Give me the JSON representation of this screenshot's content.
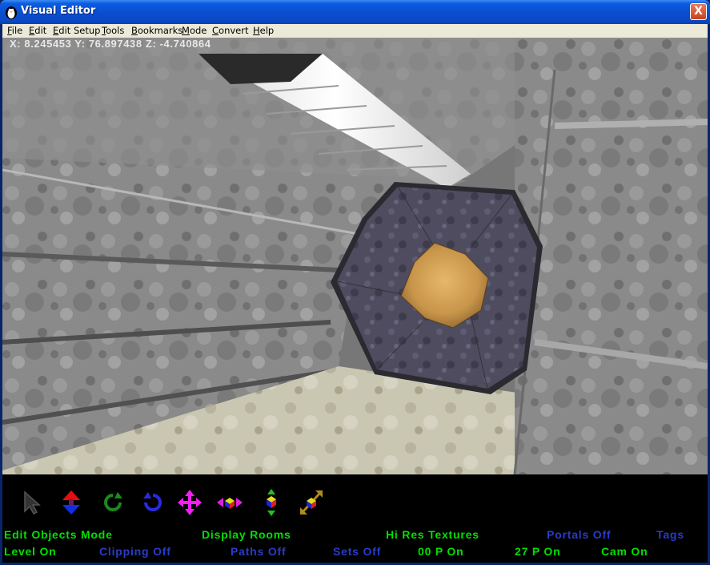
{
  "window": {
    "title": "Visual Editor",
    "close_label": "X"
  },
  "menu": [
    {
      "name": "menu-file",
      "accel": "F",
      "rest": "ile"
    },
    {
      "name": "menu-edit",
      "accel": "E",
      "rest": "dit"
    },
    {
      "name": "menu-edit-setup",
      "accel": "E",
      "rest": "dit Setup"
    },
    {
      "name": "menu-tools",
      "accel": "T",
      "rest": "ools"
    },
    {
      "name": "menu-bookmarks",
      "accel": "B",
      "rest": "ookmarks"
    },
    {
      "name": "menu-mode",
      "accel": "M",
      "rest": "ode"
    },
    {
      "name": "menu-convert",
      "accel": "C",
      "rest": "onvert"
    },
    {
      "name": "menu-help",
      "accel": "H",
      "rest": "elp"
    }
  ],
  "coords": {
    "text": "X: 8.245453 Y: 76.897438 Z: -4.740864"
  },
  "toolbar": [
    {
      "name": "select-arrow-icon"
    },
    {
      "name": "move-vertical-icon"
    },
    {
      "name": "rotate-green-icon"
    },
    {
      "name": "rotate-blue-icon"
    },
    {
      "name": "move-4way-icon"
    },
    {
      "name": "move-horizontal-cube-icon"
    },
    {
      "name": "move-vertical-cube-icon"
    },
    {
      "name": "scale-diagonal-cube-icon"
    }
  ],
  "status": {
    "row1": [
      {
        "name": "status-edit-objects-mode",
        "text": "Edit Objects Mode",
        "color": "#00e000"
      },
      {
        "name": "status-display-rooms",
        "text": "Display Rooms",
        "color": "#00e000"
      },
      {
        "name": "status-hi-res-textures",
        "text": "Hi Res Textures",
        "color": "#00e000"
      },
      {
        "name": "status-portals-off",
        "text": "Portals Off",
        "color": "#2a3cc8"
      },
      {
        "name": "status-tags",
        "text": "Tags",
        "color": "#2a3cc8"
      }
    ],
    "row2": [
      {
        "name": "status-level-on",
        "text": "Level On",
        "color": "#00e000"
      },
      {
        "name": "status-clipping-off",
        "text": "Clipping Off",
        "color": "#2a3cc8"
      },
      {
        "name": "status-paths-off",
        "text": "Paths Off",
        "color": "#2a3cc8"
      },
      {
        "name": "status-sets-off",
        "text": "Sets Off",
        "color": "#2a3cc8"
      },
      {
        "name": "status-00p-on",
        "text": "00 P On",
        "color": "#00e000"
      },
      {
        "name": "status-27p-on",
        "text": "27 P On",
        "color": "#00e000"
      },
      {
        "name": "status-cam-on",
        "text": "Cam On",
        "color": "#00e000"
      }
    ]
  }
}
